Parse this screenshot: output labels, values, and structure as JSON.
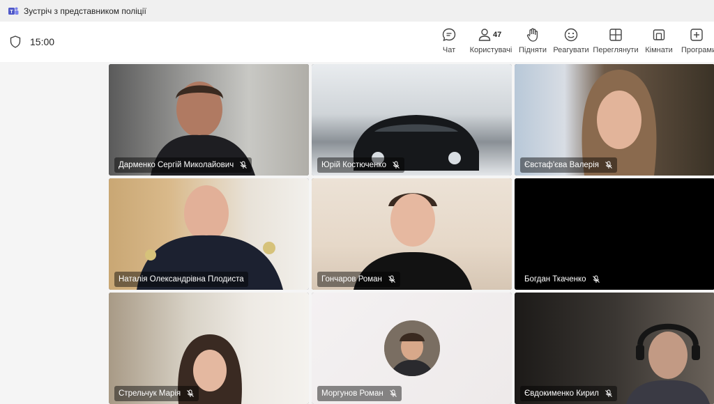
{
  "window": {
    "title": "Зустріч з представником поліції"
  },
  "meeting": {
    "timer": "15:00"
  },
  "toolbar": {
    "chat": "Чат",
    "people": "Користувачі",
    "people_count": "47",
    "raise": "Підняти",
    "react": "Реагувати",
    "view": "Переглянути",
    "rooms": "Кімнати",
    "apps": "Програми"
  },
  "participants": [
    {
      "name": "Дарменко Сергій Миколайович",
      "muted": true
    },
    {
      "name": "Юрій Костюченко",
      "muted": true
    },
    {
      "name": "Євстаф'єва Валерія",
      "muted": true
    },
    {
      "name": "Наталія Олександрівна Плодиста",
      "muted": false,
      "active": true
    },
    {
      "name": "Гончаров Роман",
      "muted": true
    },
    {
      "name": "Богдан Ткаченко",
      "muted": true
    },
    {
      "name": "Стрельчук Марія",
      "muted": true
    },
    {
      "name": "Моргунов Роман",
      "muted": true
    },
    {
      "name": "Євдокименко Кирил",
      "muted": true
    }
  ],
  "colors": {
    "accent": "#6264a7",
    "titlebar": "#f0f0f0",
    "stage": "#f5f5f5"
  },
  "icons": [
    "teams-icon",
    "shield-icon",
    "chat-icon",
    "people-icon",
    "raise-hand-icon",
    "react-icon",
    "view-icon",
    "rooms-icon",
    "apps-icon",
    "mic-off-icon"
  ]
}
